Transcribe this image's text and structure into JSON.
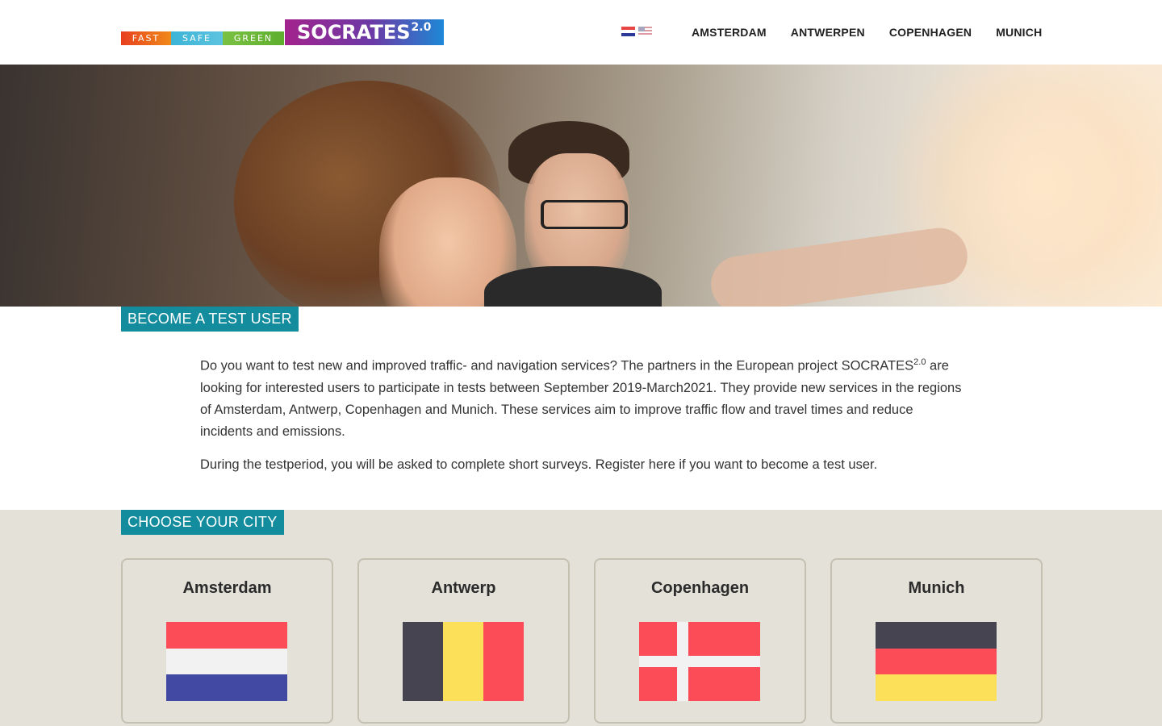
{
  "header": {
    "logo": {
      "taglines": [
        "FAST",
        "SAFE",
        "GREEN"
      ],
      "name": "SOCRATES",
      "version": "2.0"
    },
    "languages": [
      {
        "name": "dutch-flag-icon"
      },
      {
        "name": "us-flag-icon"
      }
    ],
    "nav": [
      "AMSTERDAM",
      "ANTWERPEN",
      "COPENHAGEN",
      "MUNICH"
    ]
  },
  "hero": {
    "image": "couple-driving-car-photo"
  },
  "test_user": {
    "heading": "BECOME A TEST USER",
    "paragraph1_before": "Do you want to test new and improved traffic- and navigation services?  The partners in the European project SOCRATES",
    "paragraph1_sup": "2.0",
    "paragraph1_after": " are looking for interested users to participate in tests between September 2019-March2021. They provide new services in the regions of Amsterdam, Antwerp, Copenhagen and Munich. These services aim to improve traffic flow and travel times and reduce incidents and emissions.",
    "paragraph2": "During the testperiod, you will be asked to complete short surveys. Register here if you want to become a test user."
  },
  "city_section": {
    "heading": "CHOOSE YOUR CITY",
    "cities": [
      {
        "name": "Amsterdam",
        "flag": "netherlands-flag"
      },
      {
        "name": "Antwerp",
        "flag": "belgium-flag"
      },
      {
        "name": "Copenhagen",
        "flag": "denmark-flag"
      },
      {
        "name": "Munich",
        "flag": "germany-flag"
      }
    ]
  },
  "colors": {
    "section_label": "#138c9d",
    "city_background": "#e3e1d8",
    "card_border": "#c4c1b2"
  }
}
